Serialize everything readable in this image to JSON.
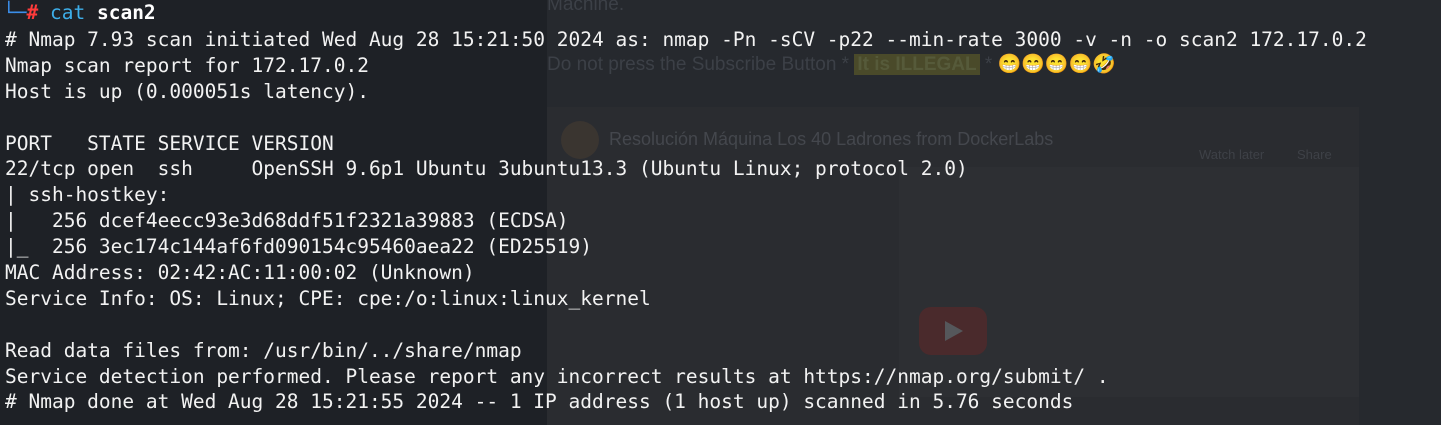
{
  "background_page": {
    "line1": "Machine.",
    "line2_prefix": "Do not press the Subscribe Button * ",
    "line2_highlight": "It is ILLEGAL",
    "line2_suffix": " * 😁😁😁😁🤣",
    "video_title": "Resolución Máquina Los 40 Ladrones from DockerLabs",
    "watch_later": "Watch later",
    "share": "Share"
  },
  "terminal": {
    "prompt_corner": "└─",
    "prompt_symbol": "#",
    "command": "cat",
    "command_arg": "scan2",
    "output": [
      "# Nmap 7.93 scan initiated Wed Aug 28 15:21:50 2024 as: nmap -Pn -sCV -p22 --min-rate 3000 -v -n -o scan2 172.17.0.2",
      "Nmap scan report for 172.17.0.2",
      "Host is up (0.000051s latency).",
      "",
      "PORT   STATE SERVICE VERSION",
      "22/tcp open  ssh     OpenSSH 9.6p1 Ubuntu 3ubuntu13.3 (Ubuntu Linux; protocol 2.0)",
      "| ssh-hostkey:",
      "|   256 dcef4eecc93e3d68ddf51f2321a39883 (ECDSA)",
      "|_  256 3ec174c144af6fd090154c95460aea22 (ED25519)",
      "MAC Address: 02:42:AC:11:00:02 (Unknown)",
      "Service Info: OS: Linux; CPE: cpe:/o:linux:linux_kernel",
      "",
      "Read data files from: /usr/bin/../share/nmap",
      "Service detection performed. Please report any incorrect results at https://nmap.org/submit/ .",
      "# Nmap done at Wed Aug 28 15:21:55 2024 -- 1 IP address (1 host up) scanned in 5.76 seconds"
    ]
  },
  "colors": {
    "prompt_corner": "#3b8eea",
    "prompt_symbol": "#ff3b3b",
    "command": "#3daee9",
    "text": "#f2f2f2"
  }
}
